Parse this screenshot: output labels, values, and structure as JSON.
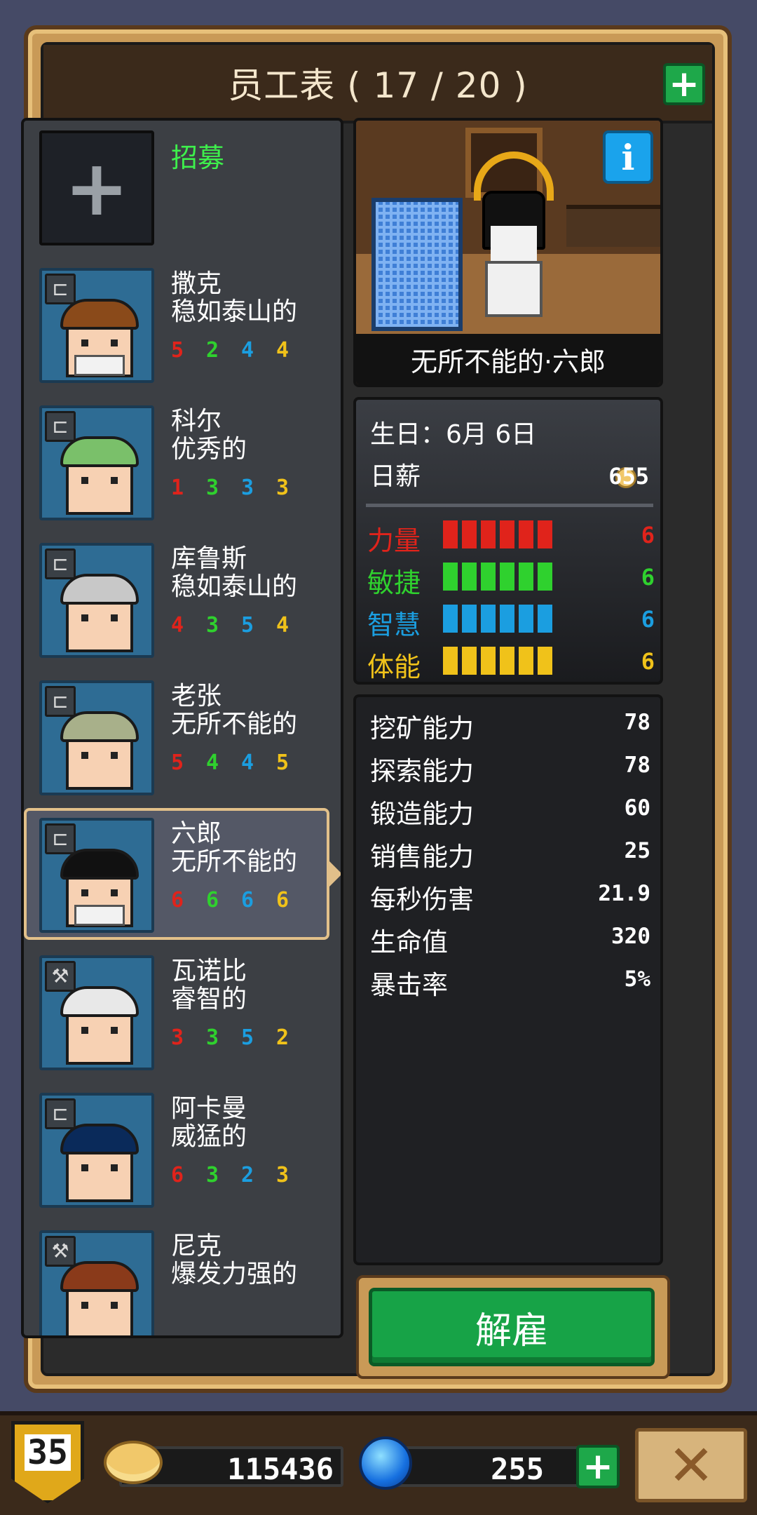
{
  "title": "员工表 ( 17 / 20 )",
  "recruit_label": "招募",
  "employees": [
    {
      "name": "撒克",
      "title": "稳如泰山的",
      "stats": [
        "5",
        "2",
        "4",
        "4"
      ],
      "hair": "#8a4a1a"
    },
    {
      "name": "科尔",
      "title": "优秀的",
      "stats": [
        "1",
        "3",
        "3",
        "3"
      ],
      "hair": "#7ac06a"
    },
    {
      "name": "库鲁斯",
      "title": "稳如泰山的",
      "stats": [
        "4",
        "3",
        "5",
        "4"
      ],
      "hair": "#c8c8c8"
    },
    {
      "name": "老张",
      "title": "无所不能的",
      "stats": [
        "5",
        "4",
        "4",
        "5"
      ],
      "hair": "#a8b08a"
    },
    {
      "name": "六郎",
      "title": "无所不能的",
      "stats": [
        "6",
        "6",
        "6",
        "6"
      ],
      "hair": "#111111",
      "selected": true
    },
    {
      "name": "瓦诺比",
      "title": "睿智的",
      "stats": [
        "3",
        "3",
        "5",
        "2"
      ],
      "hair": "#e8e8e8"
    },
    {
      "name": "阿卡曼",
      "title": "威猛的",
      "stats": [
        "6",
        "3",
        "2",
        "3"
      ],
      "hair": "#0a2a5a"
    },
    {
      "name": "尼克",
      "title": "爆发力强的",
      "stats": [
        "",
        "",
        "",
        ""
      ],
      "hair": "#8a3a1a"
    }
  ],
  "selected": {
    "display_name": "无所不能的·六郎",
    "birthday": "生日：6月 6日",
    "salary_label": "日薪",
    "salary_value": "655",
    "attributes": [
      {
        "label": "力量",
        "value": "6",
        "level": 6,
        "color": "#e0231b"
      },
      {
        "label": "敏捷",
        "value": "6",
        "level": 6,
        "color": "#2fd12e"
      },
      {
        "label": "智慧",
        "value": "6",
        "level": 6,
        "color": "#1b9ee0"
      },
      {
        "label": "体能",
        "value": "6",
        "level": 6,
        "color": "#f0c21a"
      }
    ],
    "abilities": [
      {
        "label": "挖矿能力",
        "value": "78"
      },
      {
        "label": "探索能力",
        "value": "78"
      },
      {
        "label": "锻造能力",
        "value": "60"
      },
      {
        "label": "销售能力",
        "value": "25"
      },
      {
        "label": "每秒伤害",
        "value": "21.9"
      },
      {
        "label": "生命值",
        "value": "320"
      },
      {
        "label": "暴击率",
        "value": "5%"
      }
    ]
  },
  "fire_label": "解雇",
  "bottom": {
    "level": "35",
    "gold": "115436",
    "gems": "255"
  },
  "icons": {
    "plus": "+",
    "info": "i",
    "close": "✕",
    "bed": "⊏",
    "hammer": "⚒"
  }
}
